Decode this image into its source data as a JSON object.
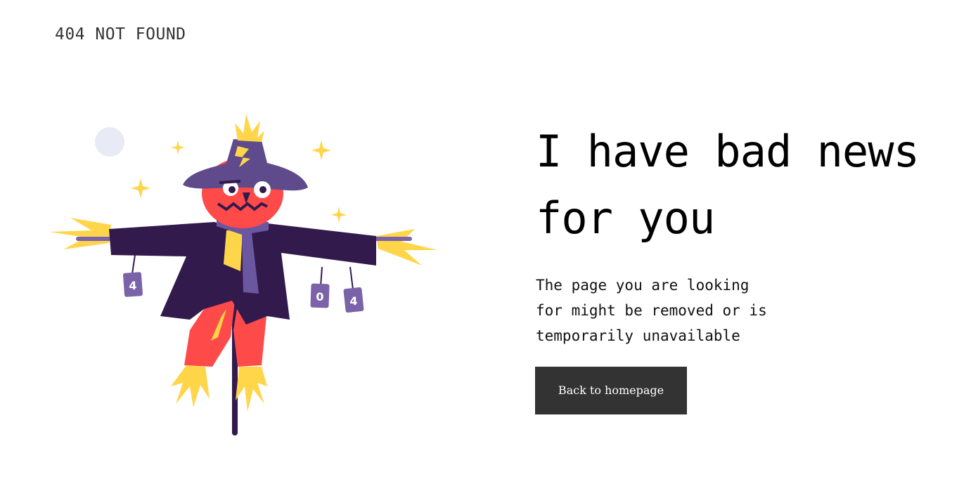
{
  "header": {
    "label": "404 NOT FOUND"
  },
  "illustration": {
    "can_digits": [
      "4",
      "0",
      "4"
    ],
    "colors": {
      "hat": "#5f4b8b",
      "coat": "#331a4d",
      "face": "#ff4a4a",
      "straw": "#ffd54a",
      "moon": "#e8ebf5",
      "scarf": "#6a57a0"
    }
  },
  "main": {
    "headline_line1": "I have bad news",
    "headline_line2": "for you",
    "description_line1": "The page you are looking",
    "description_line2": "for might be removed or is",
    "description_line3": "temporarily unavailable",
    "button_label": "Back to homepage"
  }
}
